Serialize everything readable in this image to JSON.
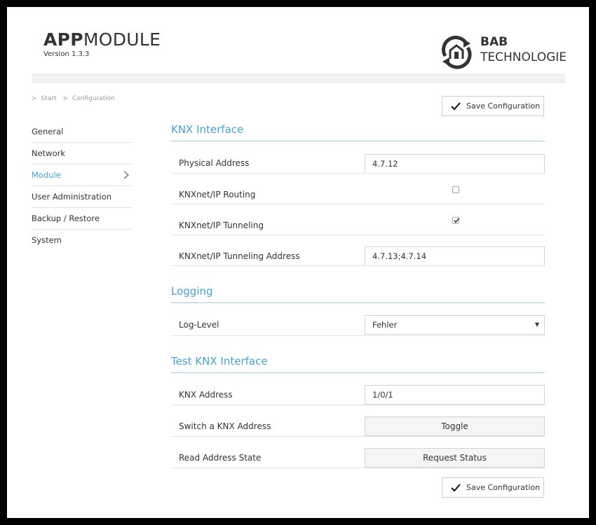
{
  "header": {
    "app_title_bold": "APP",
    "app_title_rest": "MODULE",
    "version": "Version 1.3.3",
    "brand_line1": "BAB",
    "brand_line2": "TECHNOLOGIE",
    "brand_icon": "bab-house-logo-icon"
  },
  "breadcrumb": {
    "separator": ">",
    "items": [
      "Start",
      "Configuration"
    ]
  },
  "sidebar": {
    "items": [
      {
        "label": "General"
      },
      {
        "label": "Network"
      },
      {
        "label": "Module",
        "active": true
      },
      {
        "label": "User Administration"
      },
      {
        "label": "Backup / Restore"
      },
      {
        "label": "System"
      }
    ]
  },
  "actions": {
    "save_label": "Save Configuration"
  },
  "knx_interface": {
    "title": "KNX Interface",
    "physical_address_label": "Physical Address",
    "physical_address_value": "4.7.12",
    "routing_label": "KNXnet/IP Routing",
    "routing_checked": false,
    "tunneling_label": "KNXnet/IP Tunneling",
    "tunneling_checked": true,
    "tunneling_address_label": "KNXnet/IP Tunneling Address",
    "tunneling_address_value": "4.7.13;4.7.14"
  },
  "logging": {
    "title": "Logging",
    "log_level_label": "Log-Level",
    "log_level_value": "Fehler"
  },
  "test_knx": {
    "title": "Test KNX Interface",
    "knx_address_label": "KNX Address",
    "knx_address_value": "1/0/1",
    "switch_label": "Switch a KNX Address",
    "toggle_label": "Toggle",
    "read_label": "Read Address State",
    "request_label": "Request Status"
  },
  "colors": {
    "accent": "#4ba1d9",
    "text": "#333333",
    "muted": "#9a9a9a"
  }
}
